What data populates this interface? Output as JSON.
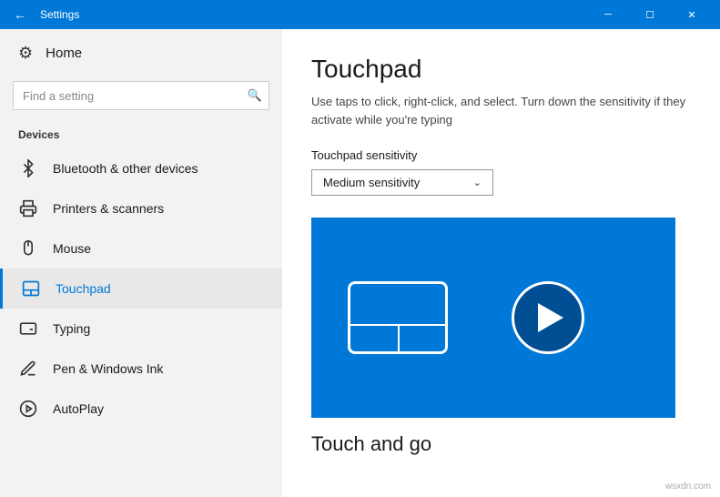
{
  "titleBar": {
    "title": "Settings",
    "backIcon": "←",
    "minimizeIcon": "─",
    "maximizeIcon": "☐",
    "closeIcon": "✕"
  },
  "sidebar": {
    "homeLabel": "Home",
    "searchPlaceholder": "Find a setting",
    "sectionLabel": "Devices",
    "items": [
      {
        "id": "bluetooth",
        "label": "Bluetooth & other devices",
        "icon": "bluetooth"
      },
      {
        "id": "printers",
        "label": "Printers & scanners",
        "icon": "printer"
      },
      {
        "id": "mouse",
        "label": "Mouse",
        "icon": "mouse"
      },
      {
        "id": "touchpad",
        "label": "Touchpad",
        "icon": "touchpad",
        "active": true
      },
      {
        "id": "typing",
        "label": "Typing",
        "icon": "typing"
      },
      {
        "id": "pen",
        "label": "Pen & Windows Ink",
        "icon": "pen"
      },
      {
        "id": "autoplay",
        "label": "AutoPlay",
        "icon": "autoplay"
      }
    ]
  },
  "content": {
    "title": "Touchpad",
    "description": "Use taps to click, right-click, and select. Turn down the sensitivity if they activate while you're typing",
    "sensitivityLabel": "Touchpad sensitivity",
    "sensitivityValue": "Medium sensitivity",
    "videoSectionTitle": "Touch and go"
  },
  "watermark": "wsxdn.com"
}
